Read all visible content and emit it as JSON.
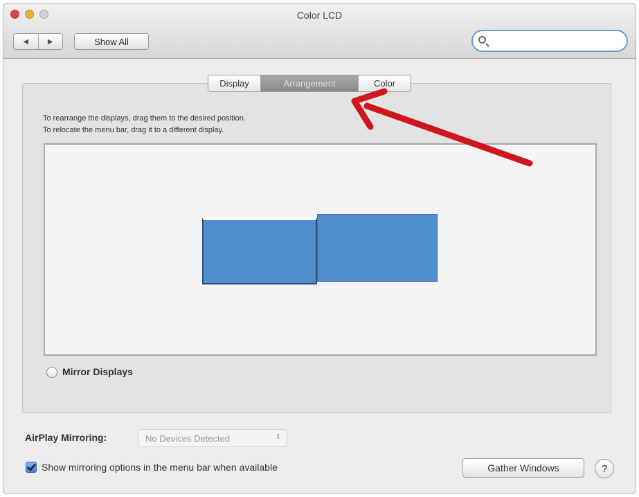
{
  "window": {
    "title": "Color LCD"
  },
  "toolbar": {
    "back_glyph": "◀",
    "forward_glyph": "▶",
    "show_all_label": "Show All",
    "search_value": "",
    "search_placeholder": ""
  },
  "tabs": [
    {
      "label": "Display",
      "selected": false
    },
    {
      "label": "Arrangement",
      "selected": true
    },
    {
      "label": "Color",
      "selected": false
    }
  ],
  "arrangement": {
    "instruction_line1": "To rearrange the displays, drag them to the desired position.",
    "instruction_line2": "To relocate the menu bar, drag it to a different display.",
    "display_color": "#4f8fcf"
  },
  "mirror_displays": {
    "label": "Mirror Displays",
    "checked": false
  },
  "airplay": {
    "label": "AirPlay Mirroring:",
    "selected_value": "No Devices Detected",
    "arrows_glyph": "⇕"
  },
  "show_mirroring": {
    "label": "Show mirroring options in the menu bar when available",
    "checked": true
  },
  "buttons": {
    "gather_windows": "Gather Windows",
    "help": "?"
  },
  "colors": {
    "annotation_arrow": "#d0161c",
    "accent": "#4f8fcf"
  },
  "icons": {
    "search": "search-icon",
    "help": "help-icon",
    "annotation": "red-arrow-icon"
  }
}
